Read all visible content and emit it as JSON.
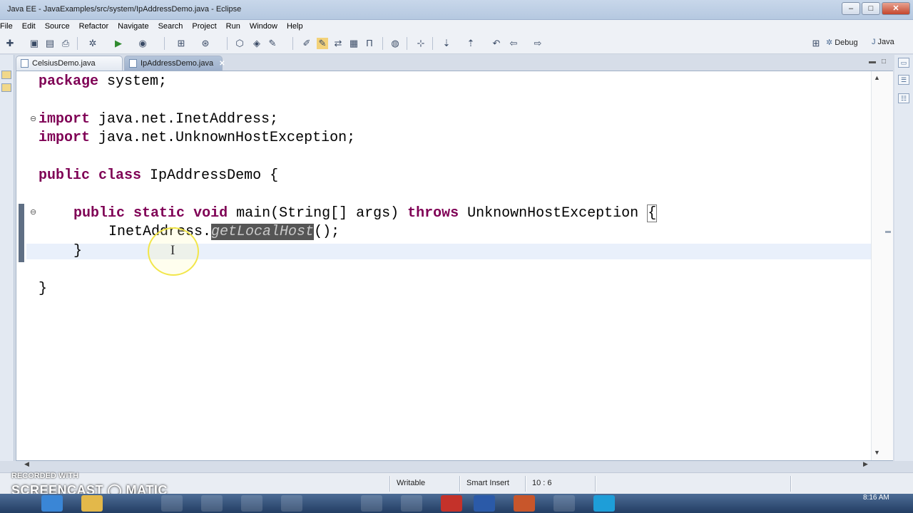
{
  "window": {
    "title": "Java EE - JavaExamples/src/system/IpAddressDemo.java - Eclipse"
  },
  "menu": [
    "File",
    "Edit",
    "Source",
    "Refactor",
    "Navigate",
    "Search",
    "Project",
    "Run",
    "Window",
    "Help"
  ],
  "toolbar": {
    "perspectives": [
      "Debug",
      "Java"
    ]
  },
  "tabs": [
    {
      "label": "CelsiusDemo.java",
      "active": false
    },
    {
      "label": "IpAddressDemo.java",
      "active": true
    }
  ],
  "code": {
    "package_kw": "package",
    "package_name": " system;",
    "import_kw": "import",
    "import1": " java.net.InetAddress;",
    "import2": " java.net.UnknownHostException;",
    "class_kw1": "public",
    "class_kw2": "class",
    "class_name": " IpAddressDemo {",
    "main_kw1": "public",
    "main_kw2": "static",
    "main_kw3": "void",
    "main_sig": " main(String[] args) ",
    "main_kw4": "throws",
    "main_tail": " UnknownHostException ",
    "main_brace": "{",
    "call_pre": "InetAddress.",
    "call_method": "getLocalHost",
    "call_post": "();",
    "close_method": "}",
    "close_class": "}"
  },
  "status": {
    "mode": "Writable",
    "insert": "Smart Insert",
    "position": "10 : 6"
  },
  "watermark": {
    "line1": "RECORDED WITH",
    "line2": "SCREENCAST  ◯ MATIC"
  },
  "clock": "8:16 AM",
  "colors": {
    "keyword": "#7f0055",
    "current_line": "#e9f0fb",
    "highlight": "#555555"
  }
}
